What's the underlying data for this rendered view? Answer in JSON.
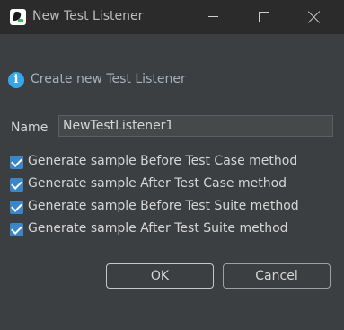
{
  "window": {
    "title": "New Test Listener"
  },
  "header": {
    "text": "Create new Test Listener"
  },
  "name": {
    "label": "Name",
    "value": "NewTestListener1"
  },
  "options": [
    {
      "label": "Generate sample Before Test Case method",
      "checked": true
    },
    {
      "label": "Generate sample After Test Case method",
      "checked": true
    },
    {
      "label": "Generate sample Before Test Suite method",
      "checked": true
    },
    {
      "label": "Generate sample After Test Suite method",
      "checked": true
    }
  ],
  "buttons": {
    "ok": "OK",
    "cancel": "Cancel"
  },
  "colors": {
    "accent": "#3a86c9",
    "info": "#3aa6ea",
    "background": "#3c3f41",
    "titlebar": "#2b2b2b"
  },
  "icons": {
    "app": "katalon-app-icon",
    "info": "info-icon",
    "minimize": "minimize-icon",
    "maximize": "maximize-icon",
    "close": "close-icon",
    "check": "checkmark-icon"
  }
}
